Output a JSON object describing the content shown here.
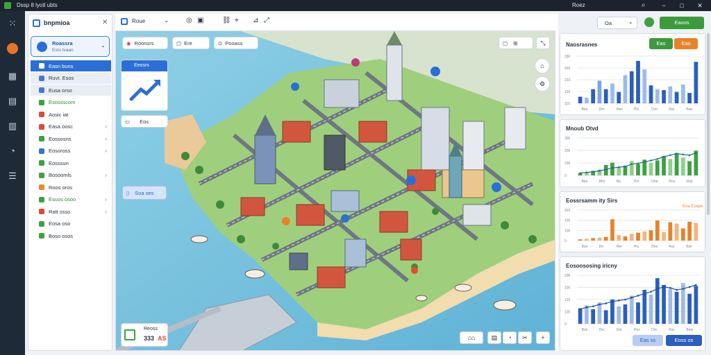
{
  "window": {
    "title": "Dssp 8 lyotl ubts",
    "center_title": "Roez",
    "controls": [
      "−",
      "□",
      "✕"
    ]
  },
  "rail": {
    "icons": [
      "grid-icon",
      "orange-logo-icon",
      "building-icon",
      "document-icon",
      "folder-icon",
      "clock-icon",
      "list-icon"
    ]
  },
  "left_panel": {
    "title": "bnpmioa",
    "project": {
      "name": "Roassra",
      "sub": "Esrs tvaan"
    },
    "items": [
      {
        "label": "Easn buns",
        "selected": true,
        "color": "#2b6fd6",
        "chevron": false
      },
      {
        "label": "Ruvt. Esos",
        "selected": false,
        "color": "#4a78c8",
        "chevron": false
      },
      {
        "label": "Eusa orso",
        "selected": false,
        "color": "#4a78c8",
        "chevron": false
      },
      {
        "label": "Esossscom",
        "selected": false,
        "color": "#3ea043",
        "chevron": false,
        "green": true
      },
      {
        "label": "Aosic iat",
        "selected": false,
        "color": "#d94b3a",
        "chevron": false
      },
      {
        "label": "Easa oosc",
        "selected": false,
        "color": "#d94b3a",
        "chevron": true
      },
      {
        "label": "Eossosns",
        "selected": false,
        "color": "#3ea043",
        "chevron": true
      },
      {
        "label": "Eosoross",
        "selected": false,
        "color": "#3b6fd1",
        "chevron": true
      },
      {
        "label": "Eosssun",
        "selected": false,
        "color": "#3ea043",
        "chevron": false
      },
      {
        "label": "Bosoomls",
        "selected": false,
        "color": "#3ea043",
        "chevron": true
      },
      {
        "label": "Roos oros",
        "selected": false,
        "color": "#e88a2e",
        "chevron": false
      },
      {
        "label": "Esuos osoo",
        "selected": false,
        "color": "#3ea043",
        "chevron": true,
        "green": true
      },
      {
        "label": "Ratt ssso",
        "selected": false,
        "color": "#d94b3a",
        "chevron": true
      },
      {
        "label": "Eosa oso",
        "selected": false,
        "color": "#3ea043",
        "chevron": false
      },
      {
        "label": "Boso osos",
        "selected": false,
        "color": "#3ea043",
        "chevron": false
      }
    ]
  },
  "main_toolbar": {
    "view_label": "Roue"
  },
  "map_chips": [
    {
      "label": "Roonsrs"
    },
    {
      "label": "Ere"
    },
    {
      "label": "Pooass"
    }
  ],
  "map_overlays": {
    "trend_card_title": "Eeosrs",
    "small_card_label": "Eos",
    "layer_card_label": "Soa oes",
    "legend_value": "333",
    "legend_unit": "AS",
    "legend_title": "Reoss"
  },
  "top_right": {
    "search_label": "Oa",
    "primary_button": "Eaoos"
  },
  "charts": {
    "chart1": {
      "title": "Naosrasnes",
      "buttons": [
        {
          "label": "Eas",
          "color": "#3c9a3c"
        },
        {
          "label": "Eao",
          "color": "#e8832a"
        }
      ],
      "chart_data": {
        "type": "bar",
        "title": "Naosrasnes",
        "ylabels": [
          "330",
          "320",
          "210",
          "150",
          "110"
        ],
        "xlabels": [
          "Ben",
          "Dm",
          "Ren",
          "Pis",
          "Dvn",
          "Rat",
          "Bae"
        ],
        "values": [
          14,
          12,
          30,
          48,
          30,
          42,
          24,
          60,
          68,
          90,
          72,
          38,
          30,
          28,
          36,
          24,
          40,
          22,
          88
        ],
        "color_pattern": [
          "#2b5fbd",
          "#9fbbe8",
          "#2b5fbd",
          "#7fa4e0",
          "#2b5fbd",
          "#9fbbe8",
          "#2b5fbd",
          "#9fbbe8",
          "#2b5fbd",
          "#2b5fbd",
          "#9fbbe8",
          "#2b5fbd",
          "#9fbbe8",
          "#2b5fbd",
          "#9fbbe8",
          "#2b5fbd",
          "#9fbbe8",
          "#2b5fbd",
          "#2b5fbd"
        ],
        "ylim": [
          0,
          100
        ]
      }
    },
    "chart2": {
      "title": "Mnoub Otvd",
      "chart_data": {
        "type": "bar",
        "title": "Mnoub Otvd",
        "ylabels": [
          "300",
          "200",
          "190",
          "0"
        ],
        "xlabels": [
          "Bes",
          "Blm",
          "Ba",
          "Pnr",
          "Ohe",
          "Rns",
          "Riat"
        ],
        "values": [
          6,
          8,
          12,
          16,
          28,
          34,
          22,
          26,
          38,
          30,
          42,
          34,
          40,
          52,
          44,
          60,
          48,
          38,
          66
        ],
        "line": [
          6,
          8,
          10,
          12,
          16,
          20,
          22,
          24,
          30,
          32,
          36,
          40,
          44,
          50,
          54,
          58,
          56,
          54,
          60
        ],
        "color_pattern": [
          "#3ea043",
          "#8fd08a",
          "#3ea043",
          "#8fd08a",
          "#3ea043",
          "#3ea043",
          "#8fd08a",
          "#3ea043",
          "#8fd08a",
          "#3ea043",
          "#3ea043",
          "#8fd08a",
          "#3ea043",
          "#3ea043",
          "#8fd08a",
          "#3ea043",
          "#8fd08a",
          "#3ea043",
          "#3ea043"
        ],
        "ylim": [
          0,
          100
        ]
      }
    },
    "chart3": {
      "title": "Eossrsamm ity Sirs",
      "legend": "Eua Eosps",
      "chart_data": {
        "type": "bar",
        "title": "Eossrsamm ity Sirs",
        "ylabels": [
          "320",
          "100",
          "100",
          "0"
        ],
        "xlabels": [
          "Boo",
          "Dn",
          "Ror",
          "Pis",
          "Dno",
          "Rat",
          "Biis"
        ],
        "values": [
          4,
          6,
          8,
          10,
          12,
          70,
          18,
          14,
          22,
          26,
          30,
          34,
          66,
          28,
          60,
          56,
          40,
          62,
          58
        ],
        "color_pattern": [
          "#e8832a",
          "#f3b57c",
          "#e8832a",
          "#f3b57c",
          "#e8832a",
          "#e8832a",
          "#f3b57c",
          "#e8832a",
          "#f3b57c",
          "#e8832a",
          "#f3b57c",
          "#e8832a",
          "#e8832a",
          "#f3b57c",
          "#e8832a",
          "#f3b57c",
          "#e8832a",
          "#e8832a",
          "#f3b57c"
        ],
        "ylim": [
          0,
          100
        ]
      }
    },
    "chart4": {
      "title": "Eosoososing iricny",
      "chart_data": {
        "type": "bar",
        "title": "Eosoososing iricny",
        "ylabels": [
          "200",
          "100",
          "120",
          "100",
          "0"
        ],
        "xlabels": [
          "Bon",
          "Din",
          "Dor",
          "Pes",
          "Dre",
          "Rar",
          "Beis"
        ],
        "values": [
          32,
          38,
          30,
          44,
          28,
          50,
          36,
          40,
          58,
          44,
          70,
          60,
          94,
          80,
          72,
          66,
          84,
          62,
          78
        ],
        "line": [
          30,
          34,
          36,
          40,
          42,
          46,
          48,
          50,
          54,
          58,
          62,
          66,
          72,
          76,
          74,
          70,
          72,
          76,
          80
        ],
        "color_pattern": [
          "#2b5fbd",
          "#9fbbe8",
          "#2b5fbd",
          "#9fbbe8",
          "#2b5fbd",
          "#2b5fbd",
          "#9fbbe8",
          "#2b5fbd",
          "#9fbbe8",
          "#2b5fbd",
          "#2b5fbd",
          "#9fbbe8",
          "#2b5fbd",
          "#2b5fbd",
          "#9fbbe8",
          "#2b5fbd",
          "#9fbbe8",
          "#2b5fbd",
          "#2b5fbd"
        ],
        "ylim": [
          0,
          100
        ]
      },
      "buttons": [
        {
          "label": "Eas ss",
          "color": "#b8cdf2"
        },
        {
          "label": "Eoss os",
          "color": "#2b5fbd"
        }
      ]
    }
  }
}
